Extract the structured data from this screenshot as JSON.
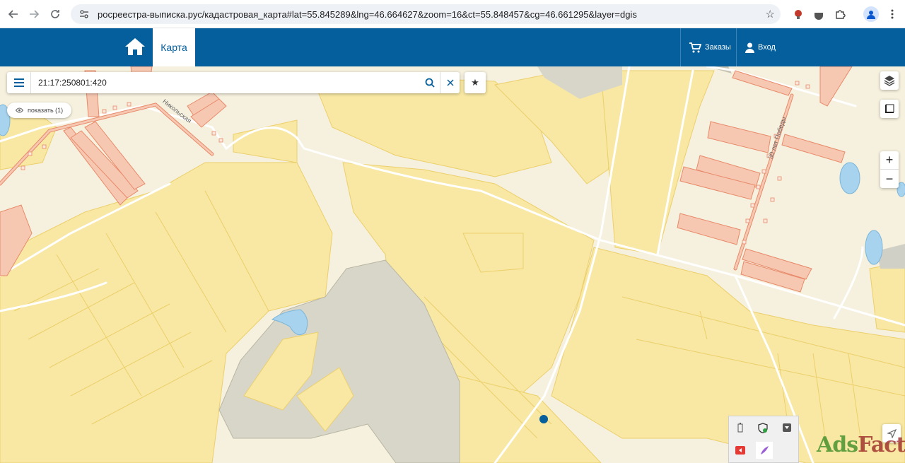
{
  "browser": {
    "url": "росреестра-выписка.рус/кадастровая_карта#lat=55.845289&lng=46.664627&zoom=16&ct=55.848457&cg=46.661295&layer=dgis"
  },
  "header": {
    "tab_map": "Карта",
    "orders_label": "Заказы",
    "login_label": "Вход"
  },
  "search": {
    "value": "21:17:250801:420"
  },
  "map": {
    "show_pill": "показать (1)",
    "street_nikolskaya": "Никольская",
    "street_30_let_pobedy": "30 лет Победы",
    "zoom_in": "+",
    "zoom_out": "−"
  },
  "watermark": {
    "part1": "Ads",
    "part2": "Factory"
  },
  "colors": {
    "brand": "#055f9c",
    "parcel_fill": "#f8e8a3",
    "building_fill": "#f6c8b2",
    "building_stroke": "#e88a6a",
    "water": "#a7d3ee",
    "quarry": "#d8d6c8"
  }
}
